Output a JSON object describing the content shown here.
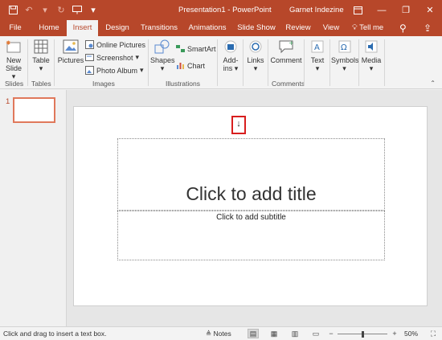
{
  "window": {
    "title": "Presentation1 - PowerPoint",
    "user": "Garnet Indezine"
  },
  "tabs": [
    "File",
    "Home",
    "Insert",
    "Design",
    "Transitions",
    "Animations",
    "Slide Show",
    "Review",
    "View"
  ],
  "active_tab": "Insert",
  "tell_me": "Tell me",
  "ribbon": {
    "new_slide": [
      "New",
      "Slide"
    ],
    "table": "Table",
    "pictures": "Pictures",
    "online_pictures": "Online Pictures",
    "screenshot": "Screenshot",
    "photo_album": "Photo Album",
    "shapes": "Shapes",
    "smartart": "SmartArt",
    "chart": "Chart",
    "addins": [
      "Add-",
      "ins"
    ],
    "links": "Links",
    "comment": "Comment",
    "text": "Text",
    "symbols": "Symbols",
    "media": "Media",
    "groups": {
      "slides": "Slides",
      "tables": "Tables",
      "images": "Images",
      "illustrations": "Illustrations",
      "comments": "Comments"
    }
  },
  "thumbnail": {
    "number": "1"
  },
  "slide": {
    "cursor_glyph": "↓",
    "title_placeholder": "Click to add title",
    "subtitle_placeholder": "Click to add subtitle"
  },
  "status": {
    "message": "Click and drag to insert a text box.",
    "notes": "Notes",
    "zoom_level": "50%",
    "zoom_fraction": 0.5
  },
  "colors": {
    "accent": "#b7472a",
    "highlight": "#d81e1e"
  }
}
